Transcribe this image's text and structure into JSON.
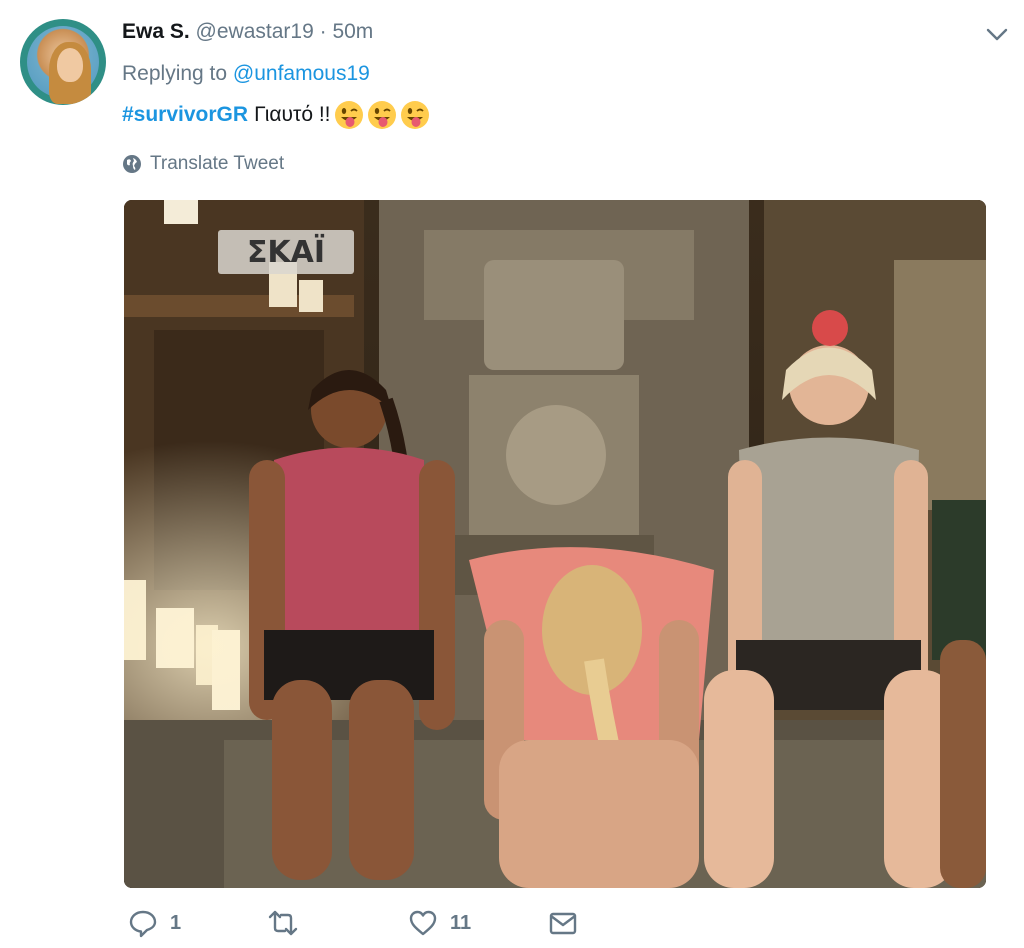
{
  "tweet": {
    "author_name": "Ewa S.",
    "author_handle": "@ewastar19",
    "separator": "·",
    "time": "50m",
    "replying_prefix": "Replying to",
    "replying_to": "@unfamous19",
    "hashtag": "#survivorGR",
    "text": "Γιαυτό !!",
    "emojis": [
      "winking-tongue-emoji",
      "winking-tongue-emoji",
      "winking-tongue-emoji"
    ],
    "translate_label": "Translate Tweet",
    "media_watermark": "ΣΚΑΪ"
  },
  "actions": {
    "reply_count": "1",
    "retweet_count": "",
    "like_count": "11"
  },
  "colors": {
    "link": "#1b95e0",
    "secondary_text": "#657786",
    "primary_text": "#14171a"
  },
  "icons": {
    "menu": "chevron-down-icon",
    "translate": "globe-icon",
    "reply": "reply-icon",
    "retweet": "retweet-icon",
    "like": "heart-icon",
    "dm": "envelope-icon"
  }
}
